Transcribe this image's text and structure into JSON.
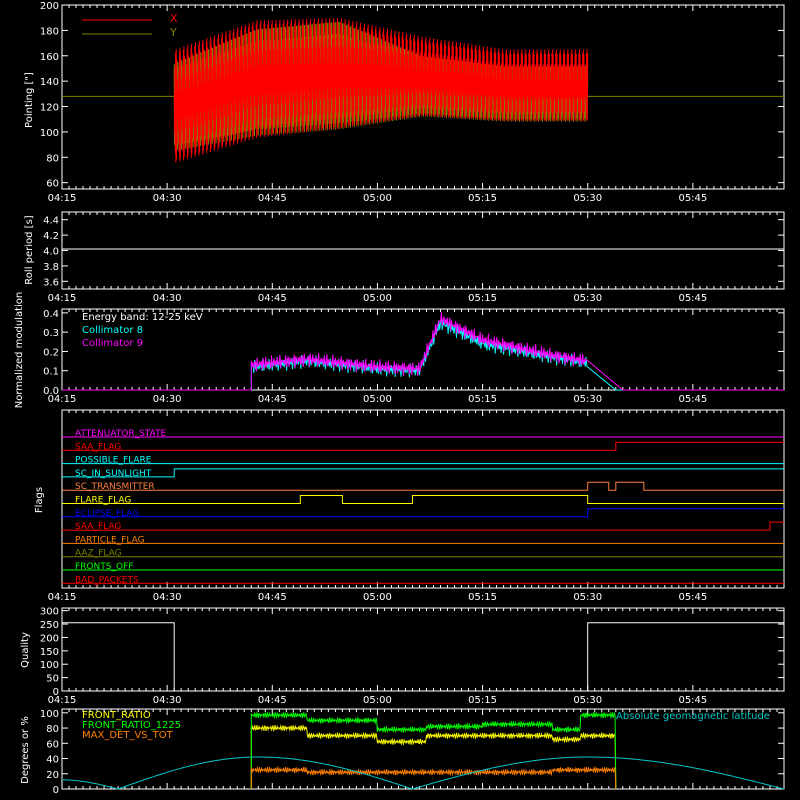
{
  "colors": {
    "x_pointing": "#ff0000",
    "y_pointing": "#808000",
    "roll": "#ffffff",
    "coll8": "#00ffff",
    "coll9": "#ff00ff",
    "quality": "#ffffff",
    "front_ratio": "#ffff00",
    "front_ratio_1225": "#00ff00",
    "max_det": "#ff8000",
    "geomag": "#00c8c8"
  },
  "chart_data": [
    {
      "type": "line",
      "ylabel": "Pointing [\"]",
      "ylim": [
        55,
        200
      ],
      "yticks": [
        60,
        80,
        100,
        120,
        140,
        160,
        180,
        200
      ],
      "xlim": [
        "04:15",
        "05:58"
      ],
      "xticks": [
        "04:15",
        "04:30",
        "04:45",
        "05:00",
        "05:15",
        "05:30",
        "05:45"
      ],
      "legend": [
        "X",
        "Y"
      ],
      "legend_position": "top-left",
      "series": [
        {
          "name": "X",
          "data_start": "04:31",
          "data_end": "05:30",
          "envelope_max": [
            165,
            188,
            190,
            175,
            165,
            165
          ],
          "envelope_min": [
            75,
            95,
            102,
            112,
            108,
            108
          ]
        },
        {
          "name": "Y",
          "data_start": "04:31",
          "data_end": "05:30",
          "envelope_max": [
            155,
            182,
            188,
            160,
            152,
            152
          ],
          "envelope_min": [
            85,
            97,
            102,
            112,
            108,
            108
          ],
          "baseline": 128
        }
      ]
    },
    {
      "type": "line",
      "ylabel": "Roll period [s]",
      "ylim": [
        3.5,
        4.5
      ],
      "yticks": [
        "3.6",
        "3.8",
        "4.0",
        "4.2",
        "4.4"
      ],
      "xticks": [
        "04:15",
        "04:30",
        "04:45",
        "05:00",
        "05:15",
        "05:30",
        "05:45"
      ],
      "series": [
        {
          "name": "",
          "value": 4.02
        }
      ]
    },
    {
      "type": "line",
      "ylabel": "Normalized modulation",
      "ylim": [
        0,
        0.42
      ],
      "yticks": [
        "0.0",
        "0.1",
        "0.2",
        "0.3",
        "0.4"
      ],
      "xticks": [
        "04:15",
        "04:30",
        "04:45",
        "05:00",
        "05:15",
        "05:30",
        "05:45"
      ],
      "annotation": "Energy band: 12-25 keV",
      "legend": [
        "Collimator 8",
        "Collimator 9"
      ],
      "series": [
        {
          "name": "Collimator 8",
          "x": [
            "04:42",
            "04:50",
            "05:00",
            "05:06",
            "05:09",
            "05:15",
            "05:25",
            "05:30",
            "05:34"
          ],
          "y": [
            0.12,
            0.15,
            0.11,
            0.1,
            0.35,
            0.24,
            0.17,
            0.14,
            0.0
          ]
        },
        {
          "name": "Collimator 9",
          "x": [
            "04:42",
            "04:50",
            "05:00",
            "05:06",
            "05:09",
            "05:15",
            "05:25",
            "05:30",
            "05:35"
          ],
          "y": [
            0.13,
            0.16,
            0.12,
            0.11,
            0.37,
            0.26,
            0.18,
            0.15,
            0.0
          ]
        }
      ]
    },
    {
      "type": "line",
      "ylabel": "Flags",
      "xticks": [
        "04:15",
        "04:30",
        "04:45",
        "05:00",
        "05:15",
        "05:30",
        "05:45"
      ],
      "flags": [
        {
          "name": "ATTENUATOR_STATE",
          "color": "#ff00ff",
          "changes": []
        },
        {
          "name": "SAA_FLAG",
          "color": "#ff0000",
          "changes": [
            [
              "04:42",
              0
            ],
            [
              "05:34",
              1
            ]
          ]
        },
        {
          "name": "POSSIBLE_FLARE",
          "color": "#00ffff",
          "changes": []
        },
        {
          "name": "SC_IN_SUNLIGHT",
          "color": "#00ffff",
          "changes": [
            [
              "04:31",
              1
            ]
          ]
        },
        {
          "name": "SC_TRANSMITTER",
          "color": "#ff8040",
          "changes": [
            [
              "05:30",
              1
            ],
            [
              "05:33",
              0
            ],
            [
              "05:34",
              1
            ],
            [
              "05:38",
              0
            ]
          ]
        },
        {
          "name": "FLARE_FLAG",
          "color": "#ffff00",
          "changes": [
            [
              "04:49",
              1
            ],
            [
              "04:55",
              0
            ],
            [
              "05:05",
              1
            ],
            [
              "05:30",
              0
            ]
          ]
        },
        {
          "name": "ECLIPSE_FLAG",
          "color": "#0000ff",
          "changes": [
            [
              "04:31",
              0
            ],
            [
              "05:30",
              1
            ]
          ]
        },
        {
          "name": "SAA_FLAG",
          "color": "#ff0000",
          "changes": [
            [
              "04:40",
              0
            ],
            [
              "05:56",
              1
            ]
          ]
        },
        {
          "name": "PARTICLE_FLAG",
          "color": "#ff8000",
          "changes": []
        },
        {
          "name": "AAZ_FLAG",
          "color": "#808000",
          "changes": []
        },
        {
          "name": "FRONTS_OFF",
          "color": "#00ff00",
          "changes": []
        },
        {
          "name": "BAD_PACKETS",
          "color": "#ff0000",
          "changes": []
        }
      ]
    },
    {
      "type": "line",
      "ylabel": "Quality",
      "ylim": [
        0,
        310
      ],
      "yticks": [
        0,
        50,
        100,
        150,
        200,
        250,
        300
      ],
      "xticks": [
        "04:15",
        "04:30",
        "04:45",
        "05:00",
        "05:15",
        "05:30",
        "05:45"
      ],
      "series": [
        {
          "name": "",
          "x": [
            "04:15",
            "04:31",
            "04:31",
            "05:30",
            "05:30",
            "05:58"
          ],
          "y": [
            255,
            255,
            0,
            0,
            255,
            255
          ]
        }
      ]
    },
    {
      "type": "line",
      "ylabel": "Degrees or %",
      "ylim": [
        0,
        105
      ],
      "yticks": [
        0,
        20,
        40,
        60,
        80,
        100
      ],
      "legend": [
        "FRONT_RATIO",
        "FRONT_RATIO_1225",
        "MAX_DET_VS_TOT",
        "Absolute geomagnetic latitude"
      ],
      "series": [
        {
          "name": "FRONT_RATIO",
          "x": [
            "04:42",
            "04:50",
            "05:00",
            "05:07",
            "05:15",
            "05:25",
            "05:29",
            "05:34"
          ],
          "y": [
            80,
            70,
            62,
            70,
            70,
            65,
            70,
            70
          ]
        },
        {
          "name": "FRONT_RATIO_1225",
          "x": [
            "04:42",
            "04:50",
            "05:00",
            "05:07",
            "05:15",
            "05:25",
            "05:29",
            "05:34"
          ],
          "y": [
            97,
            90,
            78,
            82,
            85,
            78,
            97,
            97
          ]
        },
        {
          "name": "MAX_DET_VS_TOT",
          "x": [
            "04:42",
            "04:50",
            "05:00",
            "05:15",
            "05:25",
            "05:34"
          ],
          "y": [
            25,
            22,
            22,
            22,
            25,
            30
          ]
        },
        {
          "name": "Absolute geomagnetic latitude",
          "x": [
            "04:15",
            "04:23",
            "04:43",
            "05:05",
            "05:30",
            "05:58"
          ],
          "y": [
            12,
            0,
            42,
            0,
            42,
            0
          ]
        }
      ]
    }
  ]
}
